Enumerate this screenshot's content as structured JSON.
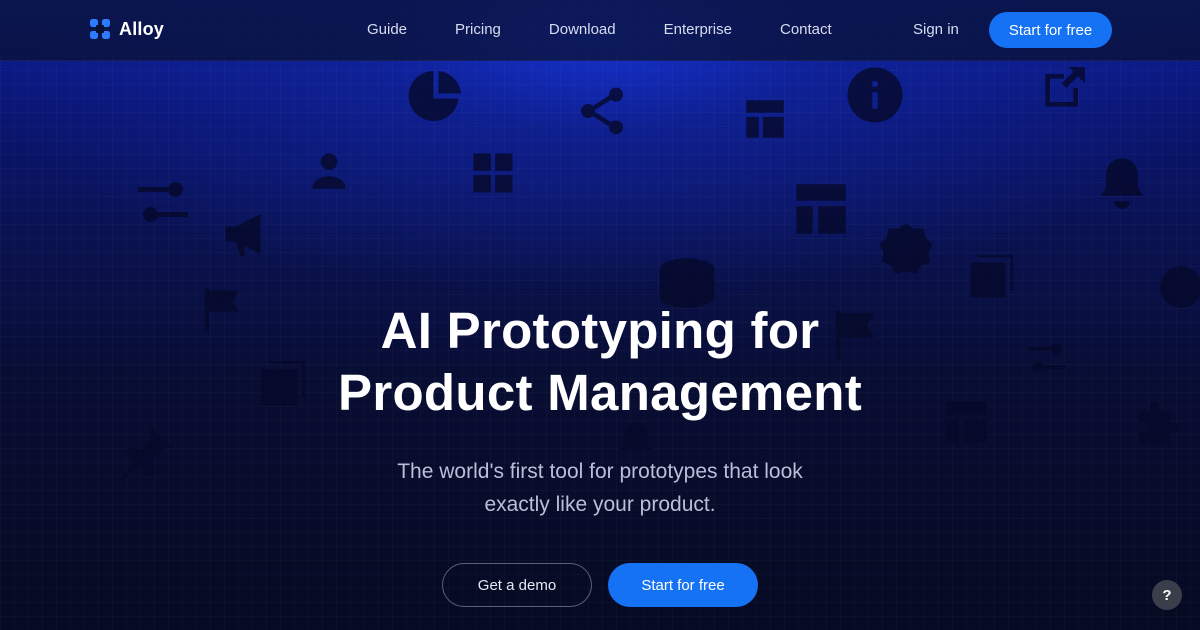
{
  "brand": {
    "name": "Alloy",
    "logo_icon": "alloy-logo-icon",
    "accent": "#1572f4"
  },
  "nav": {
    "links": [
      {
        "label": "Guide"
      },
      {
        "label": "Pricing"
      },
      {
        "label": "Download"
      },
      {
        "label": "Enterprise"
      },
      {
        "label": "Contact"
      }
    ],
    "sign_in": "Sign in",
    "cta": "Start for free"
  },
  "hero": {
    "title_line1": "AI Prototyping for",
    "title_line2": "Product Management",
    "subtitle_line1": "The world's first tool for prototypes that look",
    "subtitle_line2": "exactly like your product.",
    "demo_button": "Get a demo",
    "start_button": "Start for free"
  },
  "help": {
    "label": "?"
  },
  "background_icons": [
    "pie-chart-icon",
    "share-icon",
    "layout-icon",
    "info-icon",
    "external-link-icon",
    "user-icon",
    "grid-icon",
    "sliders-icon",
    "megaphone-icon",
    "bell-icon",
    "badge-check-icon",
    "database-icon",
    "flag-icon",
    "layers-icon",
    "pin-icon",
    "puzzle-icon",
    "check-circle-icon"
  ]
}
